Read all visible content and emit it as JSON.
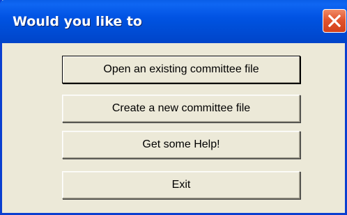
{
  "window": {
    "title": "Would you like to"
  },
  "icons": {
    "close": "close-icon"
  },
  "buttons": {
    "open_label": "Open an existing committee file",
    "create_label": "Create a new committee file",
    "help_label": "Get some Help!",
    "exit_label": "Exit"
  },
  "colors": {
    "titlebar": "#0153e3",
    "close_button": "#e2552f",
    "dialog_background": "#ece9d8",
    "title_text": "#ffffff"
  }
}
